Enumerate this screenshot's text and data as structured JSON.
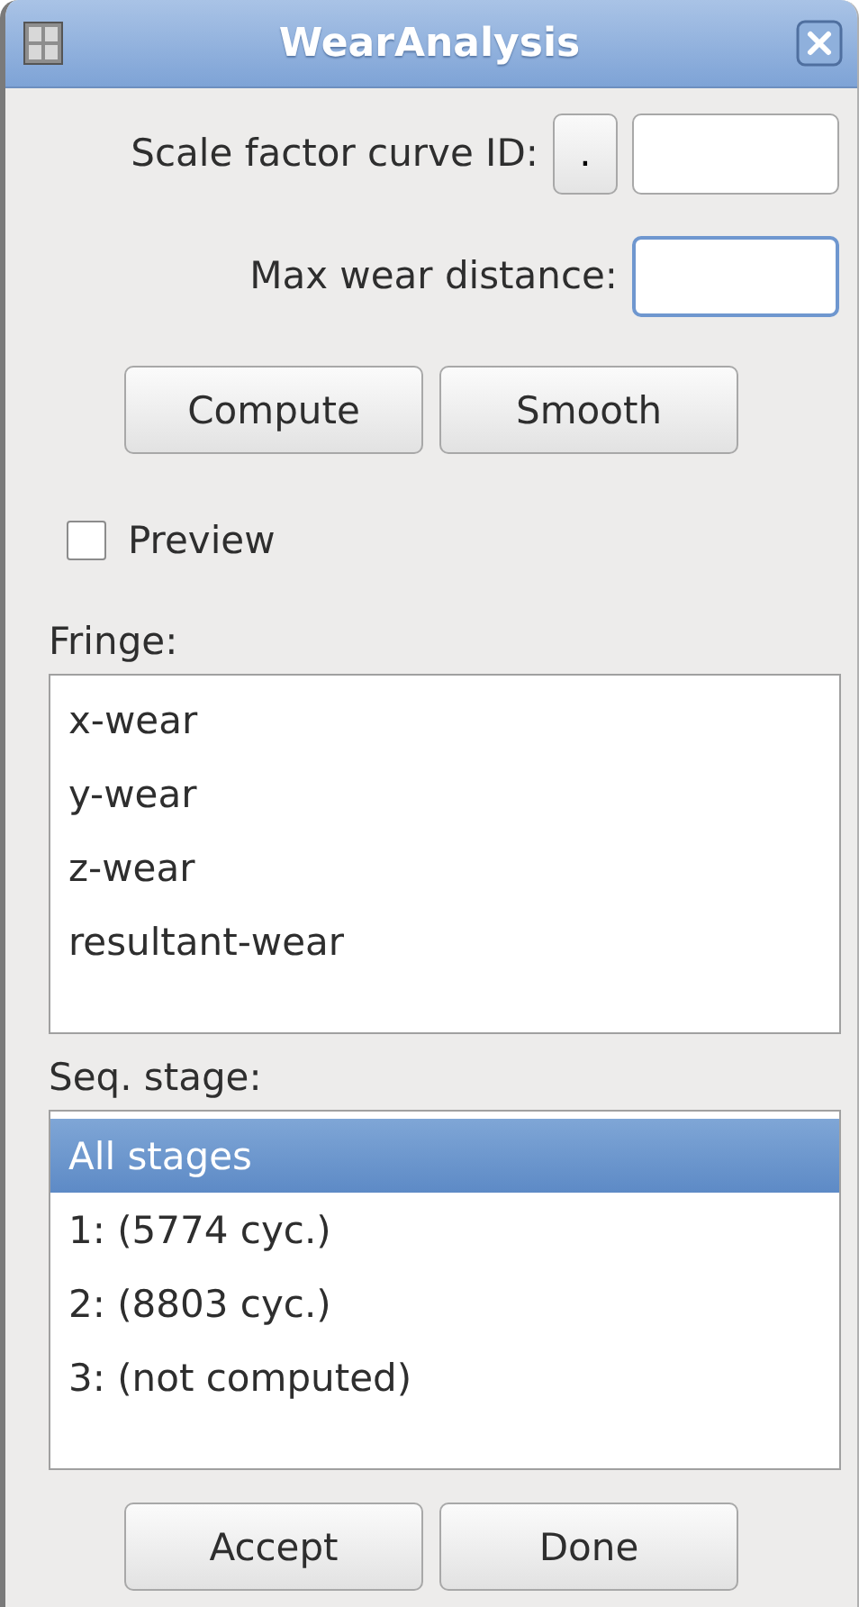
{
  "window": {
    "title": "WearAnalysis"
  },
  "scale_factor": {
    "label": "Scale factor curve ID:",
    "pick_button": "."
  },
  "max_wear": {
    "label": "Max wear distance:",
    "focused": true
  },
  "actions": [
    "Compute",
    "Smooth"
  ],
  "preview": {
    "label": "Preview",
    "checked": false
  },
  "fringe": {
    "label": "Fringe:",
    "items": [
      {
        "label": "x-wear",
        "selected": false
      },
      {
        "label": "y-wear",
        "selected": false
      },
      {
        "label": "z-wear",
        "selected": false
      },
      {
        "label": "resultant-wear",
        "selected": false
      }
    ]
  },
  "seq_stage": {
    "label": "Seq. stage:",
    "items": [
      {
        "label": "All stages",
        "selected": true
      },
      {
        "label": "1: (5774 cyc.)",
        "selected": false
      },
      {
        "label": "2: (8803 cyc.)",
        "selected": false
      },
      {
        "label": "3: (not computed)",
        "selected": false
      }
    ]
  },
  "buttons": [
    "Accept",
    "Done"
  ]
}
